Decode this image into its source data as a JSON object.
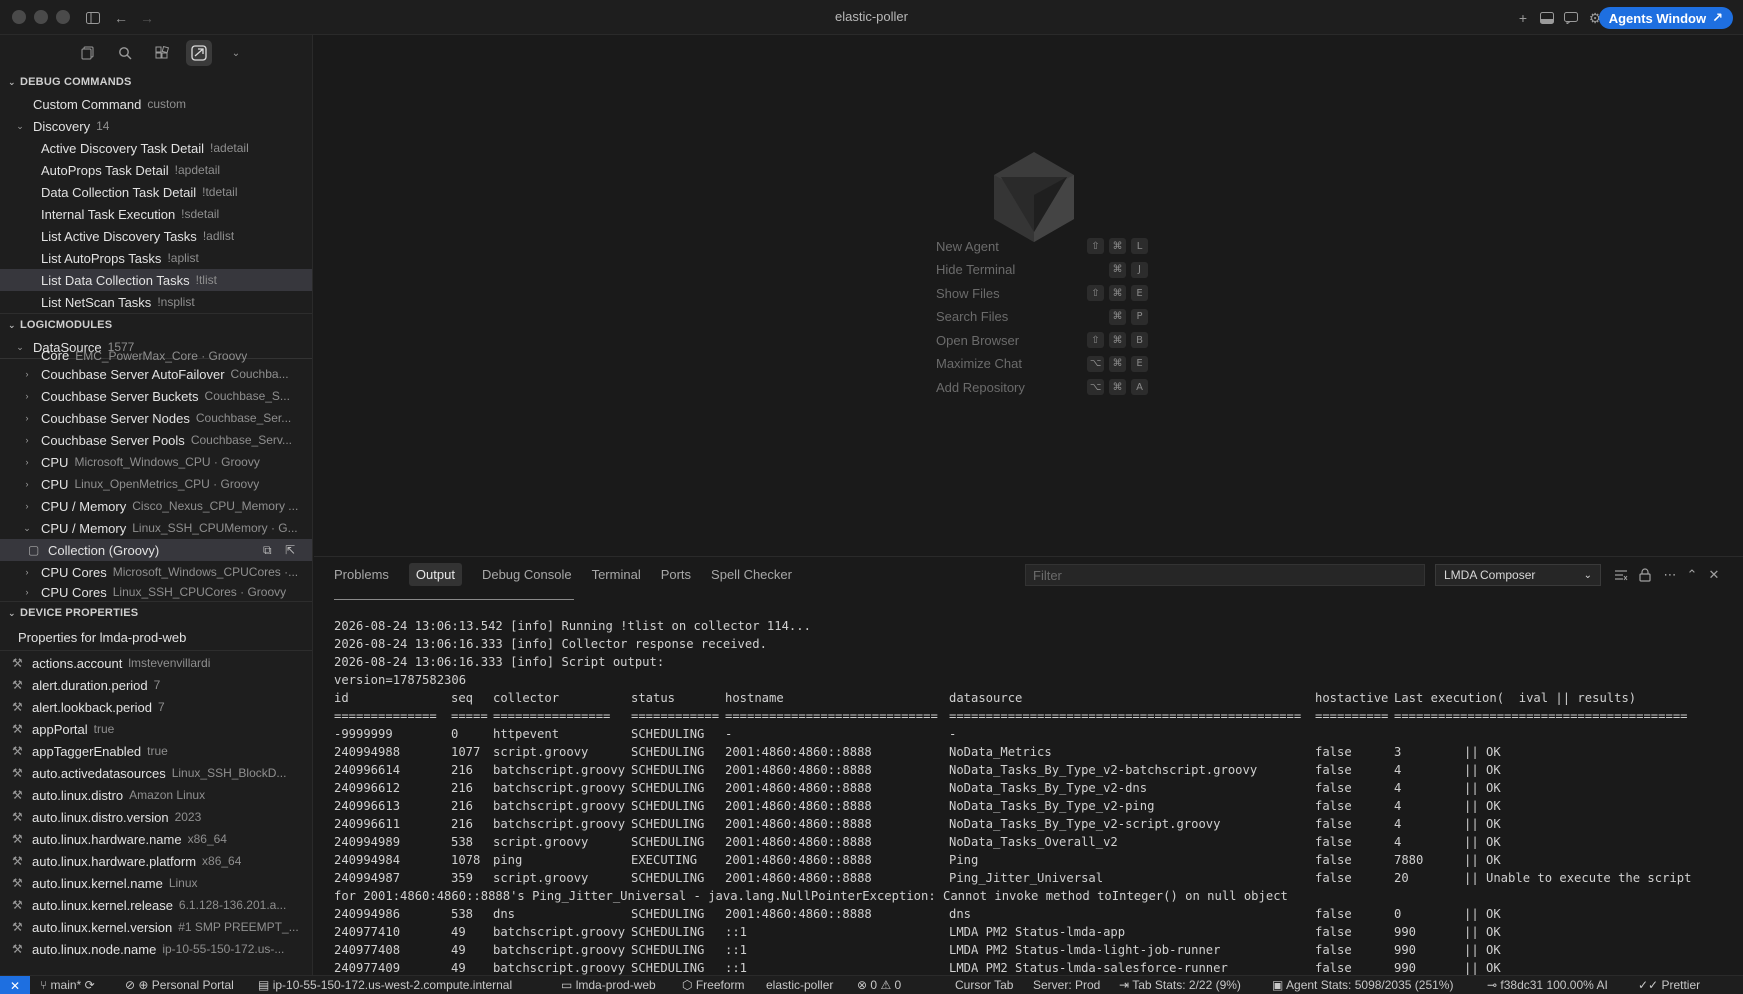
{
  "window": {
    "title": "elastic-poller",
    "agents_button": "Agents Window"
  },
  "sidebar": {
    "debug_commands": {
      "header": "DEBUG COMMANDS",
      "custom": {
        "label": "Custom Command",
        "sub": "custom"
      },
      "discovery": {
        "label": "Discovery",
        "count": "14"
      },
      "items": [
        {
          "label": "Active Discovery Task Detail",
          "sub": "!adetail"
        },
        {
          "label": "AutoProps Task Detail",
          "sub": "!apdetail"
        },
        {
          "label": "Data Collection Task Detail",
          "sub": "!tdetail"
        },
        {
          "label": "Internal Task Execution",
          "sub": "!sdetail"
        },
        {
          "label": "List Active Discovery Tasks",
          "sub": "!adlist"
        },
        {
          "label": "List AutoProps Tasks",
          "sub": "!aplist"
        },
        {
          "label": "List Data Collection Tasks",
          "sub": "!tlist"
        },
        {
          "label": "List NetScan Tasks",
          "sub": "!nsplist"
        }
      ]
    },
    "logicmodules": {
      "header": "LOGICMODULES",
      "datasource": {
        "label": "DataSource",
        "count": "1577"
      },
      "items": [
        {
          "label": "Core",
          "sub": "EMC_PowerMax_Core · Groovy"
        },
        {
          "label": "Couchbase Server AutoFailover",
          "sub": "Couchba..."
        },
        {
          "label": "Couchbase Server Buckets",
          "sub": "Couchbase_S..."
        },
        {
          "label": "Couchbase Server Nodes",
          "sub": "Couchbase_Ser..."
        },
        {
          "label": "Couchbase Server Pools",
          "sub": "Couchbase_Serv..."
        },
        {
          "label": "CPU",
          "sub": "Microsoft_Windows_CPU · Groovy"
        },
        {
          "label": "CPU",
          "sub": "Linux_OpenMetrics_CPU · Groovy"
        },
        {
          "label": "CPU / Memory",
          "sub": "Cisco_Nexus_CPU_Memory ..."
        },
        {
          "label": "CPU / Memory",
          "sub": "Linux_SSH_CPUMemory · G..."
        }
      ],
      "collection": "Collection (Groovy)",
      "items2": [
        {
          "label": "CPU Cores",
          "sub": "Microsoft_Windows_CPUCores ·..."
        },
        {
          "label": "CPU Cores",
          "sub": "Linux_SSH_CPUCores · Groovy"
        }
      ]
    },
    "device_properties": {
      "header": "DEVICE PROPERTIES",
      "title": "Properties for lmda-prod-web",
      "items": [
        {
          "label": "actions.account",
          "sub": "lmstevenvillardi"
        },
        {
          "label": "alert.duration.period",
          "sub": "7"
        },
        {
          "label": "alert.lookback.period",
          "sub": "7"
        },
        {
          "label": "appPortal",
          "sub": "true"
        },
        {
          "label": "appTaggerEnabled",
          "sub": "true"
        },
        {
          "label": "auto.activedatasources",
          "sub": "Linux_SSH_BlockD..."
        },
        {
          "label": "auto.linux.distro",
          "sub": "Amazon Linux"
        },
        {
          "label": "auto.linux.distro.version",
          "sub": "2023"
        },
        {
          "label": "auto.linux.hardware.name",
          "sub": "x86_64"
        },
        {
          "label": "auto.linux.hardware.platform",
          "sub": "x86_64"
        },
        {
          "label": "auto.linux.kernel.name",
          "sub": "Linux"
        },
        {
          "label": "auto.linux.kernel.release",
          "sub": "6.1.128-136.201.a..."
        },
        {
          "label": "auto.linux.kernel.version",
          "sub": "#1 SMP PREEMPT_..."
        },
        {
          "label": "auto.linux.node.name",
          "sub": "ip-10-55-150-172.us-..."
        }
      ]
    }
  },
  "editor": {
    "shortcuts": [
      {
        "name": "New Agent",
        "keys": [
          "⇧",
          "⌘",
          "L"
        ]
      },
      {
        "name": "Hide Terminal",
        "keys": [
          "⌘",
          "J"
        ]
      },
      {
        "name": "Show Files",
        "keys": [
          "⇧",
          "⌘",
          "E"
        ]
      },
      {
        "name": "Search Files",
        "keys": [
          "⌘",
          "P"
        ]
      },
      {
        "name": "Open Browser",
        "keys": [
          "⇧",
          "⌘",
          "B"
        ]
      },
      {
        "name": "Maximize Chat",
        "keys": [
          "⌥",
          "⌘",
          "E"
        ]
      },
      {
        "name": "Add Repository",
        "keys": [
          "⌥",
          "⌘",
          "A"
        ]
      }
    ]
  },
  "panel": {
    "tabs": [
      "Problems",
      "Output",
      "Debug Console",
      "Terminal",
      "Ports",
      "Spell Checker"
    ],
    "active_tab": "Output",
    "filter_placeholder": "Filter",
    "channel": "LMDA Composer",
    "log_lines": [
      "2026-08-24 13:06:13.542 [info] Running !tlist on collector 114...",
      "2026-08-24 13:06:16.333 [info] Collector response received.",
      "2026-08-24 13:06:16.333 [info] Script output:",
      "version=1787582306"
    ],
    "table_header": [
      "id",
      "seq",
      "collector",
      "status",
      "hostname",
      "datasource",
      "hostactive",
      "Last execution(  ival || results)"
    ],
    "table_sep": [
      "==============",
      "=====",
      "================",
      "============",
      "=============================",
      "================================================",
      "==========",
      "========================================"
    ],
    "rows": [
      [
        "-9999999",
        "0",
        "httpevent",
        "SCHEDULING",
        "-",
        "-",
        "",
        "",
        ""
      ],
      [
        "240994988",
        "1077",
        "script.groovy",
        "SCHEDULING",
        "2001:4860:4860::8888",
        "NoData_Metrics",
        "false",
        "3",
        "|| OK"
      ],
      [
        "240996614",
        "216",
        "batchscript.groovy",
        "SCHEDULING",
        "2001:4860:4860::8888",
        "NoData_Tasks_By_Type_v2-batchscript.groovy",
        "false",
        "4",
        "|| OK"
      ],
      [
        "240996612",
        "216",
        "batchscript.groovy",
        "SCHEDULING",
        "2001:4860:4860::8888",
        "NoData_Tasks_By_Type_v2-dns",
        "false",
        "4",
        "|| OK"
      ],
      [
        "240996613",
        "216",
        "batchscript.groovy",
        "SCHEDULING",
        "2001:4860:4860::8888",
        "NoData_Tasks_By_Type_v2-ping",
        "false",
        "4",
        "|| OK"
      ],
      [
        "240996611",
        "216",
        "batchscript.groovy",
        "SCHEDULING",
        "2001:4860:4860::8888",
        "NoData_Tasks_By_Type_v2-script.groovy",
        "false",
        "4",
        "|| OK"
      ],
      [
        "240994989",
        "538",
        "script.groovy",
        "SCHEDULING",
        "2001:4860:4860::8888",
        "NoData_Tasks_Overall_v2",
        "false",
        "4",
        "|| OK"
      ],
      [
        "240994984",
        "1078",
        "ping",
        "EXECUTING",
        "2001:4860:4860::8888",
        "Ping",
        "false",
        "7880",
        "|| OK"
      ],
      [
        "240994987",
        "359",
        "script.groovy",
        "SCHEDULING",
        "2001:4860:4860::8888",
        "Ping_Jitter_Universal",
        "false",
        "20",
        "|| Unable to execute the script"
      ]
    ],
    "wrap_line": "for 2001:4860:4860::8888's Ping_Jitter_Universal - java.lang.NullPointerException: Cannot invoke method toInteger() on null object",
    "rows2": [
      [
        "240994986",
        "538",
        "dns",
        "SCHEDULING",
        "2001:4860:4860::8888",
        "dns",
        "false",
        "0",
        "|| OK"
      ],
      [
        "240977410",
        "49",
        "batchscript.groovy",
        "SCHEDULING",
        "::1",
        "LMDA PM2 Status-lmda-app",
        "false",
        "990",
        "|| OK"
      ],
      [
        "240977408",
        "49",
        "batchscript.groovy",
        "SCHEDULING",
        "::1",
        "LMDA PM2 Status-lmda-light-job-runner",
        "false",
        "990",
        "|| OK"
      ],
      [
        "240977409",
        "49",
        "batchscript.groovy",
        "SCHEDULING",
        "::1",
        "LMDA PM2 Status-lmda-salesforce-runner",
        "false",
        "990",
        "|| OK"
      ]
    ]
  },
  "statusbar": {
    "branch": "main*",
    "portal": "Personal Portal",
    "host": "ip-10-55-150-172.us-west-2.compute.internal",
    "device": "lmda-prod-web",
    "freeform": "Freeform",
    "project": "elastic-poller",
    "problems": "0",
    "warnings": "0",
    "cursor_tab": "Cursor Tab",
    "server": "Server: Prod",
    "tab_stats": "Tab Stats: 2/22 (9%)",
    "agent_stats": "Agent Stats: 5098/2035 (251%)",
    "commit": "f38dc31 100.00% AI",
    "prettier": "Prettier"
  }
}
